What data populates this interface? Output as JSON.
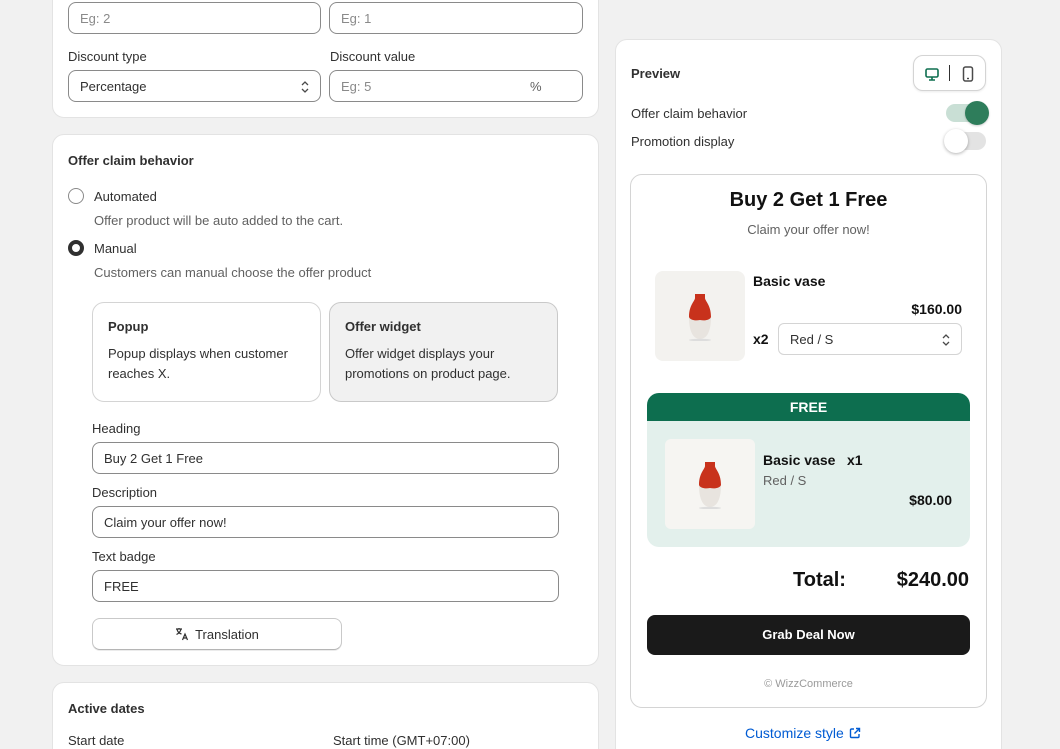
{
  "top_row": {
    "input1_placeholder": "Eg: 2",
    "input2_placeholder": "Eg: 1"
  },
  "discount": {
    "type_label": "Discount type",
    "type_value": "Percentage",
    "value_label": "Discount value",
    "value_placeholder": "Eg: 5",
    "value_suffix": "%"
  },
  "offer_claim": {
    "title": "Offer claim behavior",
    "automated_label": "Automated",
    "automated_help": "Offer product will be auto added to the cart.",
    "manual_label": "Manual",
    "manual_help": "Customers can manual choose the offer product",
    "popup_title": "Popup",
    "popup_desc": "Popup displays when customer reaches X.",
    "widget_title": "Offer widget",
    "widget_desc": "Offer widget displays your promotions on product page.",
    "heading_label": "Heading",
    "heading_value": "Buy 2 Get 1 Free",
    "description_label": "Description",
    "description_value": "Claim your offer now!",
    "badge_label": "Text badge",
    "badge_value": "FREE",
    "translation_label": "Translation"
  },
  "active_dates": {
    "title": "Active dates",
    "start_date_label": "Start date",
    "start_time_label": "Start time (GMT+07:00)"
  },
  "preview": {
    "title": "Preview",
    "toggle1_label": "Offer claim behavior",
    "toggle1_on": true,
    "toggle2_label": "Promotion display",
    "toggle2_on": false,
    "widget": {
      "heading": "Buy 2 Get 1 Free",
      "subheading": "Claim your offer now!",
      "product_name": "Basic vase",
      "product_price": "$160.00",
      "product_qty": "x2",
      "variant": "Red / S",
      "badge": "FREE",
      "free_name": "Basic vase",
      "free_qty": "x1",
      "free_variant": "Red / S",
      "free_price": "$80.00",
      "total_label": "Total:",
      "total_value": "$240.00",
      "cta": "Grab Deal Now",
      "powered": "© WizzCommerce"
    },
    "customize_link": "Customize style"
  },
  "colors": {
    "accent_green": "#2e7d5b",
    "badge_green": "#0d6e4f",
    "free_bg": "#e3f0ec",
    "cta_bg": "#1a1a1a",
    "link_blue": "#005bd3"
  }
}
